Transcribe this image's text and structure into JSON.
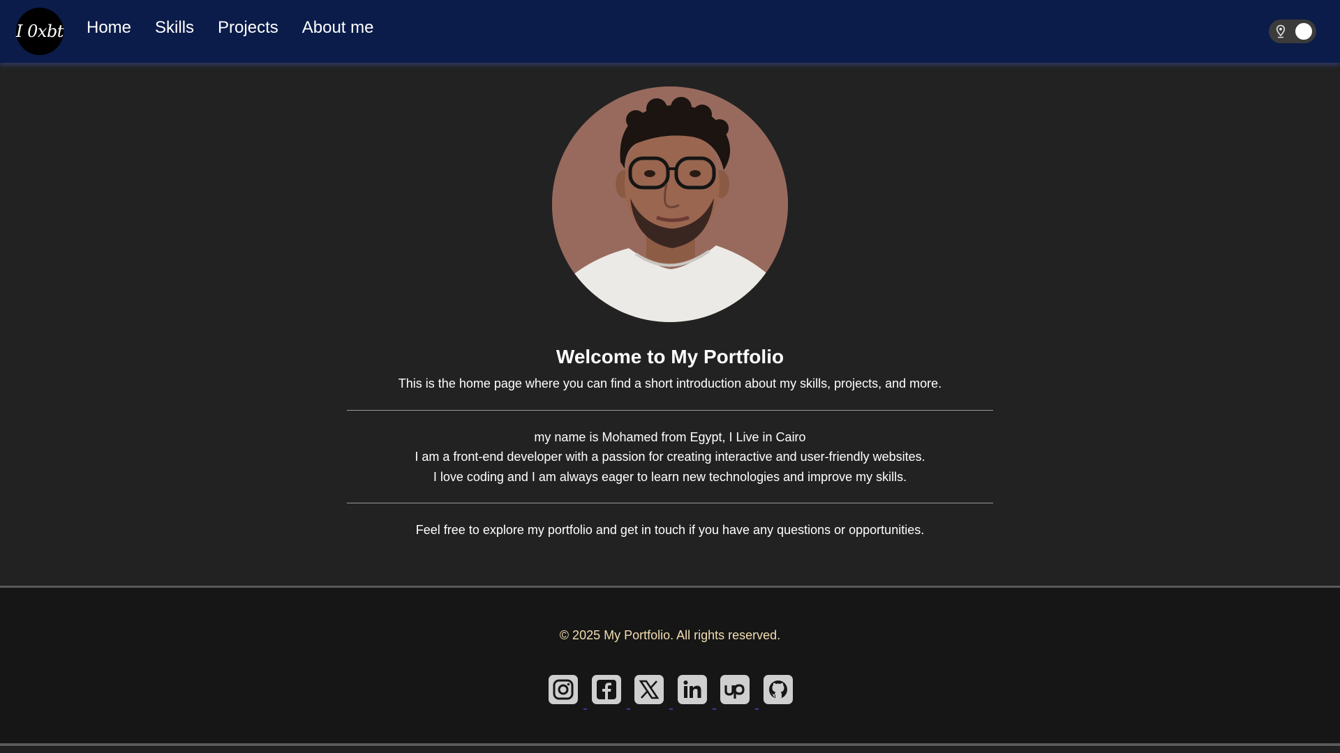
{
  "header": {
    "logo_text": "I 0xbt",
    "nav": [
      {
        "label": "Home"
      },
      {
        "label": "Skills"
      },
      {
        "label": "Projects"
      },
      {
        "label": "About me"
      }
    ],
    "theme_toggle": {
      "state": "on",
      "icon": "pin-icon"
    }
  },
  "main": {
    "title": "Welcome to My Portfolio",
    "intro": "This is the home page where you can find a short introduction about my skills, projects, and more.",
    "bio": [
      "my name is Mohamed from Egypt, I Live in Cairo",
      "I am a front-end developer with a passion for creating interactive and user-friendly websites.",
      "I love coding and I am always eager to learn new technologies and improve my skills."
    ],
    "cta": "Feel free to explore my portfolio and get in touch if you have any questions or opportunities."
  },
  "footer": {
    "copyright": "© 2025 My Portfolio. All rights reserved.",
    "socials": [
      {
        "icon": "instagram-icon"
      },
      {
        "icon": "facebook-icon"
      },
      {
        "icon": "x-icon"
      },
      {
        "icon": "linkedin-icon"
      },
      {
        "icon": "upwork-icon"
      },
      {
        "icon": "github-icon"
      }
    ]
  },
  "colors": {
    "header_bg": "#0b1c4a",
    "page_bg": "#222222",
    "footer_bg": "#161616",
    "copyright": "#f3ddb0",
    "avatar_bg": "#986a5e"
  }
}
